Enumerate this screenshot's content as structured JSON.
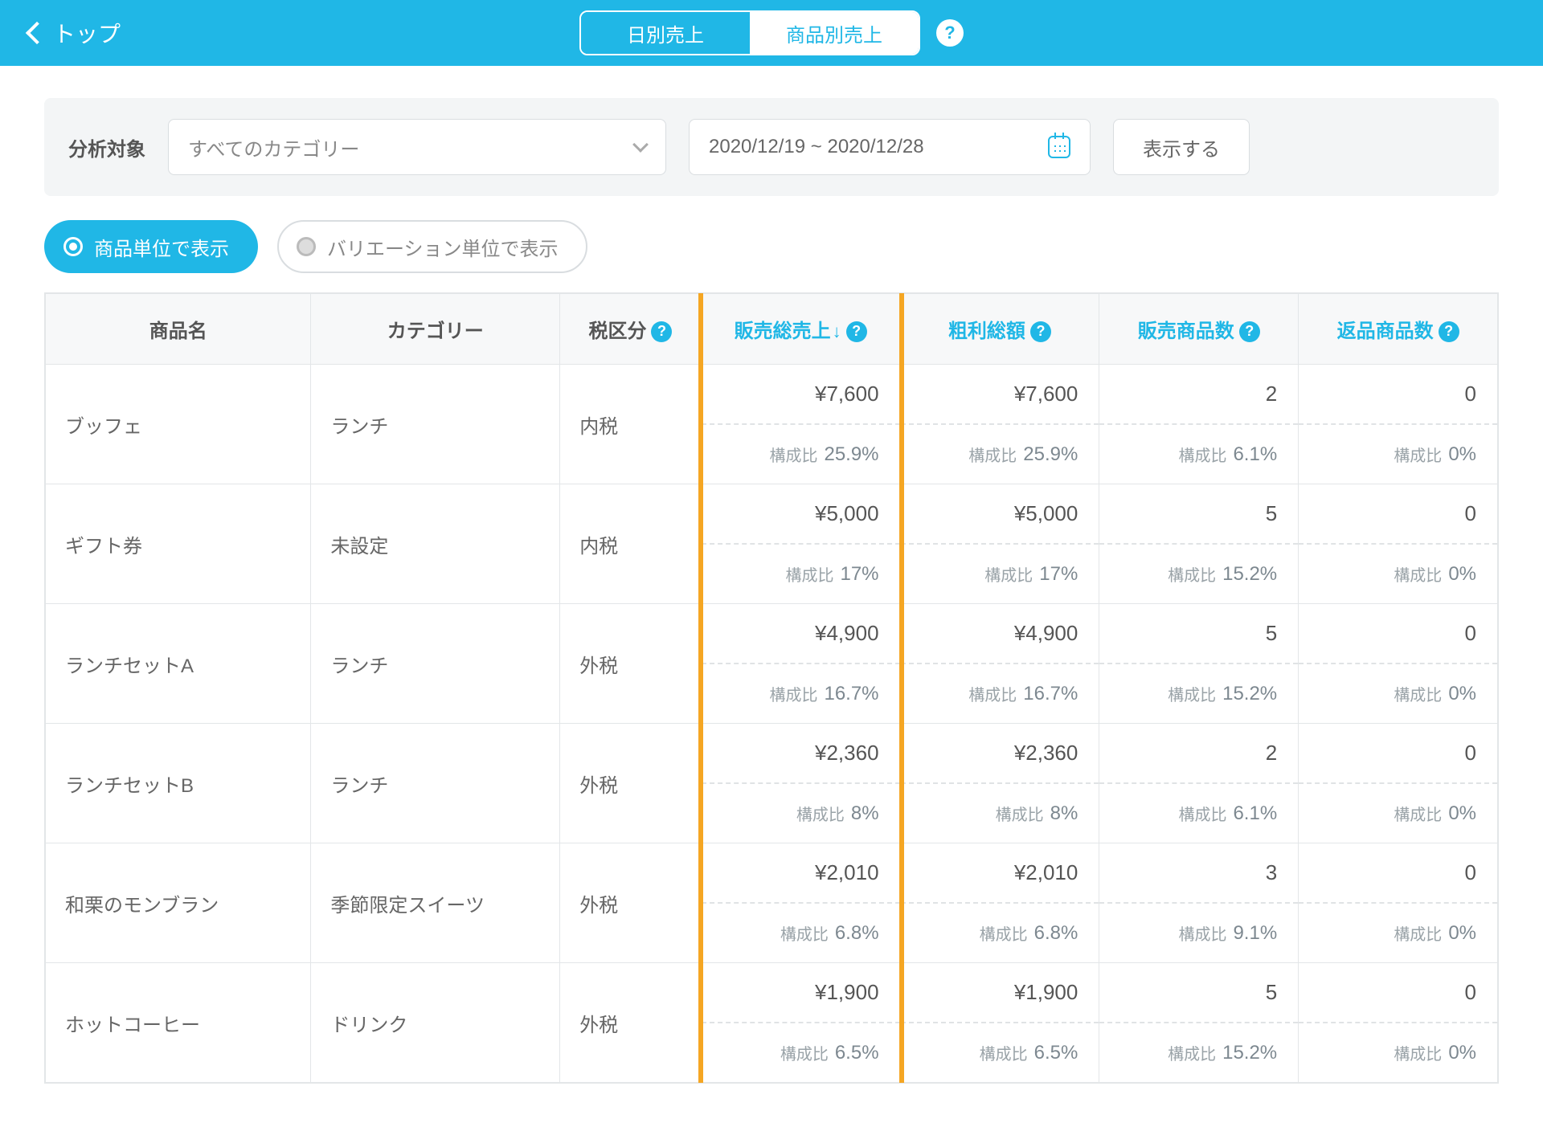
{
  "header": {
    "back_label": "トップ",
    "tab_daily": "日別売上",
    "tab_product": "商品別売上"
  },
  "filter": {
    "label": "分析対象",
    "category_value": "すべてのカテゴリー",
    "date_range": "2020/12/19 ~ 2020/12/28",
    "show_btn": "表示する"
  },
  "view_toggle": {
    "by_product": "商品単位で表示",
    "by_variation": "バリエーション単位で表示"
  },
  "columns": {
    "name": "商品名",
    "category": "カテゴリー",
    "tax": "税区分",
    "sales": "販売総売上",
    "gross": "粗利総額",
    "sold_qty": "販売商品数",
    "return_qty": "返品商品数"
  },
  "ratio_label": "構成比",
  "rows": [
    {
      "name": "ブッフェ",
      "category": "ランチ",
      "tax": "内税",
      "sales": "¥7,600",
      "sales_ratio": "25.9%",
      "gross": "¥7,600",
      "gross_ratio": "25.9%",
      "sold": "2",
      "sold_ratio": "6.1%",
      "ret": "0",
      "ret_ratio": "0%"
    },
    {
      "name": "ギフト券",
      "category": "未設定",
      "tax": "内税",
      "sales": "¥5,000",
      "sales_ratio": "17%",
      "gross": "¥5,000",
      "gross_ratio": "17%",
      "sold": "5",
      "sold_ratio": "15.2%",
      "ret": "0",
      "ret_ratio": "0%"
    },
    {
      "name": "ランチセットA",
      "category": "ランチ",
      "tax": "外税",
      "sales": "¥4,900",
      "sales_ratio": "16.7%",
      "gross": "¥4,900",
      "gross_ratio": "16.7%",
      "sold": "5",
      "sold_ratio": "15.2%",
      "ret": "0",
      "ret_ratio": "0%"
    },
    {
      "name": "ランチセットB",
      "category": "ランチ",
      "tax": "外税",
      "sales": "¥2,360",
      "sales_ratio": "8%",
      "gross": "¥2,360",
      "gross_ratio": "8%",
      "sold": "2",
      "sold_ratio": "6.1%",
      "ret": "0",
      "ret_ratio": "0%"
    },
    {
      "name": "和栗のモンブラン",
      "category": "季節限定スイーツ",
      "tax": "外税",
      "sales": "¥2,010",
      "sales_ratio": "6.8%",
      "gross": "¥2,010",
      "gross_ratio": "6.8%",
      "sold": "3",
      "sold_ratio": "9.1%",
      "ret": "0",
      "ret_ratio": "0%"
    },
    {
      "name": "ホットコーヒー",
      "category": "ドリンク",
      "tax": "外税",
      "sales": "¥1,900",
      "sales_ratio": "6.5%",
      "gross": "¥1,900",
      "gross_ratio": "6.5%",
      "sold": "5",
      "sold_ratio": "15.2%",
      "ret": "0",
      "ret_ratio": "0%"
    }
  ]
}
